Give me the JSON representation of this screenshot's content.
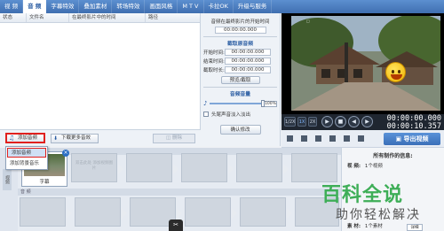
{
  "tabs": [
    "视 频",
    "音 频",
    "字幕特效",
    "叠加素材",
    "转场特效",
    "画面风格",
    "M T V",
    "卡拉OK",
    "升级与服务"
  ],
  "active_tab_index": 1,
  "table": {
    "headers": [
      "状态",
      "文件名",
      "在最终影片中的时间",
      "路径"
    ]
  },
  "audio_panel": {
    "start_label": "音频在最终影片的开始时间",
    "start_value": "00:00:00.000",
    "trim_title": "截取原音频",
    "start_time_label": "开始时间:",
    "start_time_value": "00:00:00.000",
    "end_time_label": "结束时间:",
    "end_time_value": "00:00:00.000",
    "duration_label": "截取时长:",
    "duration_value": "00:00:00.000",
    "preview_button": "预览/截取",
    "volume_title": "音频音量",
    "volume_value": "100%",
    "fade_label": "头尾声音淡入淡出",
    "confirm_button": "确认修改"
  },
  "buttons": {
    "add_audio": "添加音频",
    "download_more": "下载更多音效",
    "delete": "删除"
  },
  "dropdown": {
    "items": [
      "添加音频",
      "添加背景音乐"
    ]
  },
  "player": {
    "speed_half": "1/2X",
    "speed_one": "1X",
    "speed_two": "2X",
    "time_current": "00:00:00.000",
    "time_total": "00:00:10.357",
    "export_button": "导出视频"
  },
  "timeline": {
    "side_tab": "视频",
    "video_track_label": "视 频",
    "audio_track_label": "音 频",
    "clip_name": "字幕",
    "placeholder_text": "双击此处\n添加视频图片"
  },
  "info_panel": {
    "title": "所有制作的信息:",
    "video_label": "视 频:",
    "video_value": "1个视频",
    "material_label": "素 材:",
    "material_value": "1个素材",
    "detail_button": "详细"
  },
  "brand": {
    "main": "百科全说",
    "sub": "助你轻松解决"
  },
  "colors": {
    "tab_bar": "#4a7cc0",
    "highlight_red": "#e0201e",
    "brand_green": "#3eae57",
    "export_blue": "#3a6fb8"
  }
}
